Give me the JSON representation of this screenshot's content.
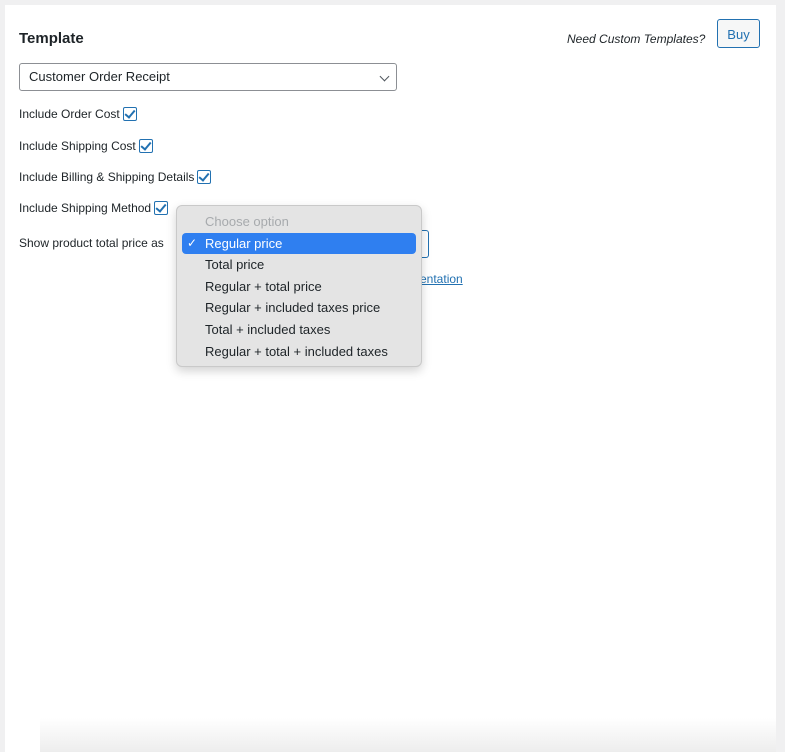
{
  "header": {
    "title": "Template",
    "custom_templates_text": "Need Custom Templates?",
    "buy_label": "Buy"
  },
  "template_select": {
    "value": "Customer Order Receipt"
  },
  "options": [
    {
      "label": "Include Order Cost",
      "checked": true
    },
    {
      "label": "Include Shipping Cost",
      "checked": true
    },
    {
      "label": "Include Billing & Shipping Details",
      "checked": true
    },
    {
      "label": "Include Shipping Method",
      "checked": true
    }
  ],
  "price_setting": {
    "label": "Show product total price as",
    "documentation_link_visible": "entation"
  },
  "dropdown": {
    "check_glyph": "✓",
    "items": [
      {
        "label": "Choose option",
        "state": "disabled"
      },
      {
        "label": "Regular price",
        "state": "selected"
      },
      {
        "label": "Total price",
        "state": "normal"
      },
      {
        "label": "Regular + total price",
        "state": "normal"
      },
      {
        "label": "Regular + included taxes price",
        "state": "normal"
      },
      {
        "label": "Total + included taxes",
        "state": "normal"
      },
      {
        "label": "Regular + total + included taxes",
        "state": "normal"
      }
    ]
  },
  "colors": {
    "accent": "#2271b1",
    "selected_highlight": "#2f7ff0",
    "background": "#f0f0f1"
  }
}
